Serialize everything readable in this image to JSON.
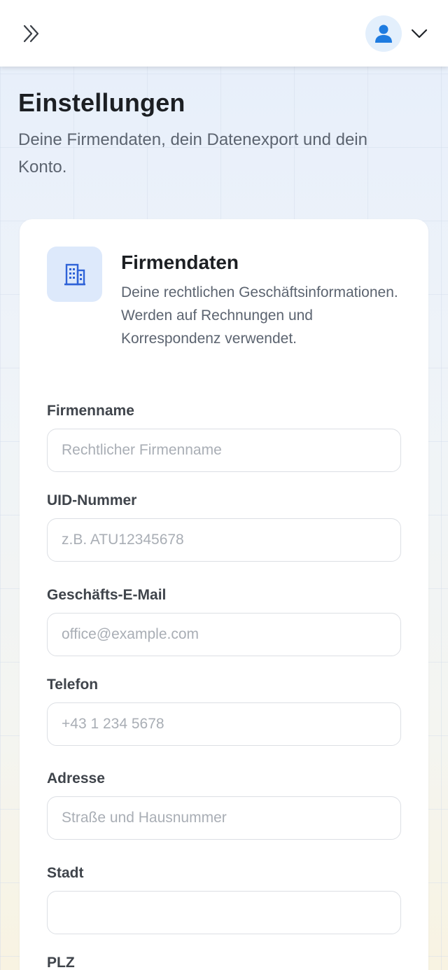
{
  "header": {
    "expand_icon": "chevrons-right-icon",
    "avatar_icon": "user-icon",
    "menu_icon": "chevron-down-icon",
    "accent": "#1e7be0"
  },
  "page": {
    "title": "Einstellungen",
    "subtitle": "Deine Firmendaten, dein Datenexport und dein Konto."
  },
  "company_section": {
    "icon": "building-icon",
    "title": "Firmendaten",
    "description": "Deine rechtlichen Geschäftsinformationen. Werden auf Rechnungen und Korrespondenz verwendet.",
    "fields": {
      "company_name": {
        "label": "Firmenname",
        "value": "",
        "placeholder": "Rechtlicher Firmenname"
      },
      "vat_number": {
        "label": "UID-Nummer",
        "value": "",
        "placeholder": "z.B. ATU12345678"
      },
      "business_email": {
        "label": "Geschäfts-E-Mail",
        "value": "",
        "placeholder": "office@example.com"
      },
      "phone": {
        "label": "Telefon",
        "value": "",
        "placeholder": "+43 1 234 5678"
      },
      "address": {
        "label": "Adresse",
        "value": "",
        "placeholder": "Straße und Hausnummer"
      },
      "city": {
        "label": "Stadt",
        "value": "",
        "placeholder": ""
      },
      "zip": {
        "label": "PLZ",
        "value": "",
        "placeholder": ""
      }
    }
  }
}
